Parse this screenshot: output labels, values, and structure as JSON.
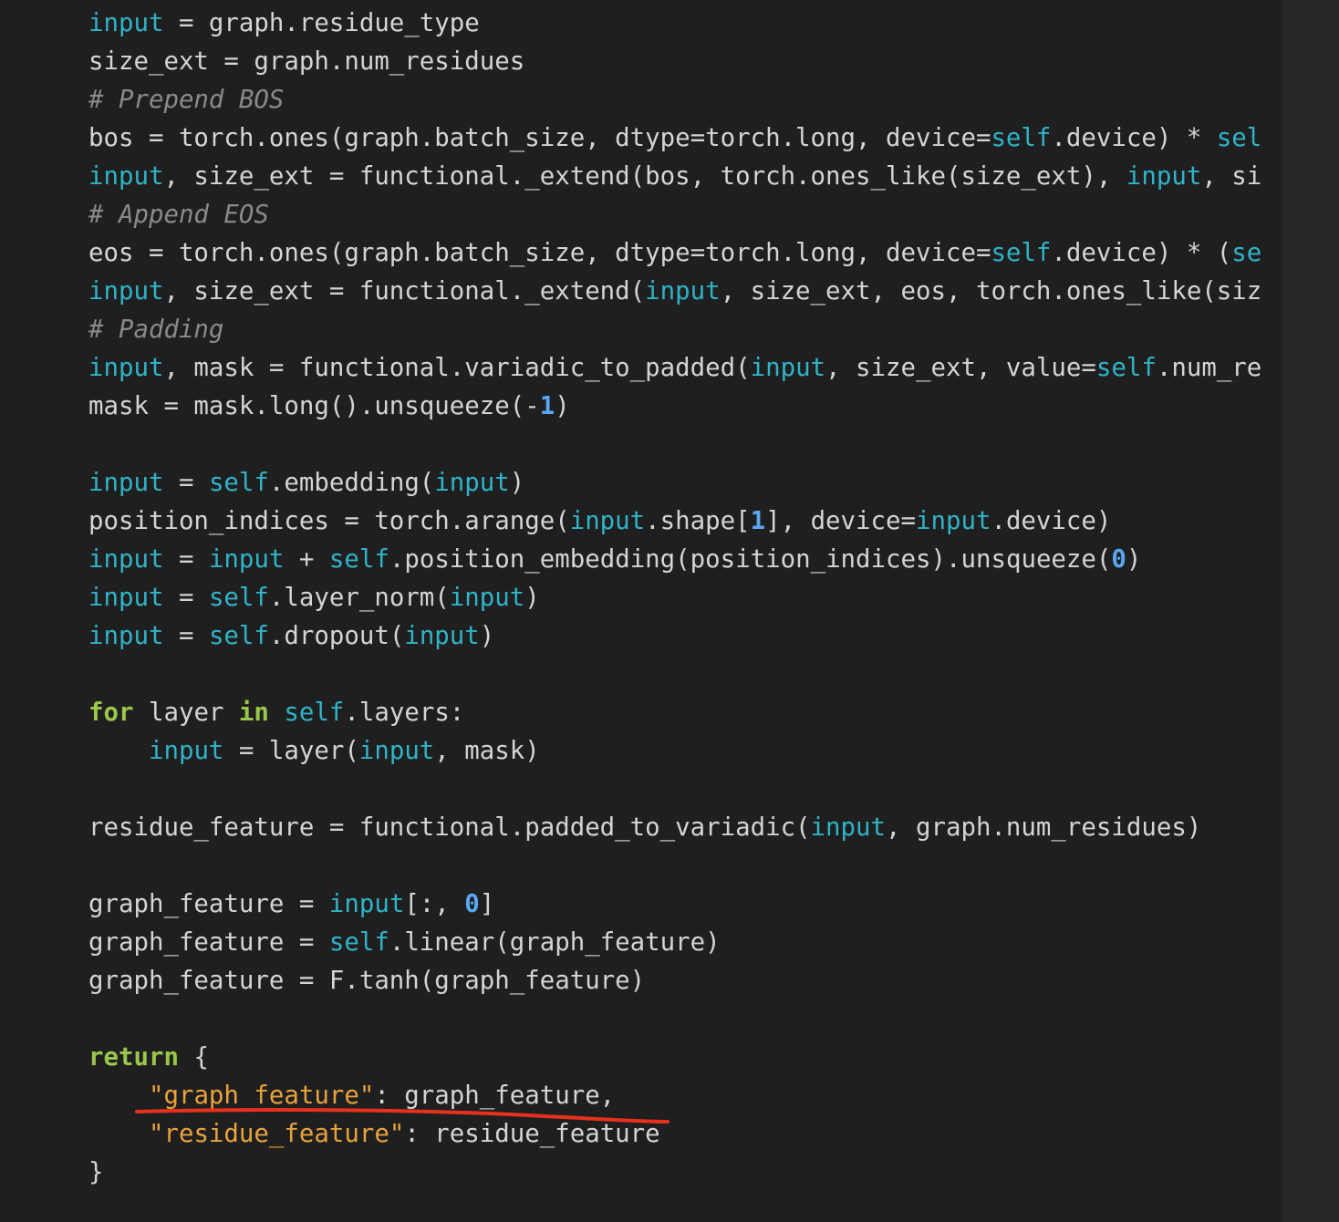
{
  "theme": {
    "background": "#1f1f1f",
    "text": "#d4d4d4",
    "keyword": "#9ac64b",
    "builtin_cyan": "#2fb3c8",
    "number": "#5aa8f4",
    "string": "#e8a33c",
    "comment": "#8a8a8a",
    "annotation_red": "#e8311c"
  },
  "code_lines": [
    [
      {
        "t": "input",
        "c": "cy"
      },
      {
        "t": " = graph.residue_type"
      }
    ],
    [
      {
        "t": "size_ext = graph.num_residues"
      }
    ],
    [
      {
        "t": "# Prepend BOS",
        "c": "cmt"
      }
    ],
    [
      {
        "t": "bos = torch.ones(graph.batch_size, dtype=torch.long, device="
      },
      {
        "t": "self",
        "c": "cy"
      },
      {
        "t": ".device) * "
      },
      {
        "t": "sel",
        "c": "cy"
      }
    ],
    [
      {
        "t": "input",
        "c": "cy"
      },
      {
        "t": ", size_ext = functional._extend(bos, torch.ones_like(size_ext), "
      },
      {
        "t": "input",
        "c": "cy"
      },
      {
        "t": ", si"
      }
    ],
    [
      {
        "t": "# Append EOS",
        "c": "cmt"
      }
    ],
    [
      {
        "t": "eos = torch.ones(graph.batch_size, dtype=torch.long, device="
      },
      {
        "t": "self",
        "c": "cy"
      },
      {
        "t": ".device) * ("
      },
      {
        "t": "se",
        "c": "cy"
      }
    ],
    [
      {
        "t": "input",
        "c": "cy"
      },
      {
        "t": ", size_ext = functional._extend("
      },
      {
        "t": "input",
        "c": "cy"
      },
      {
        "t": ", size_ext, eos, torch.ones_like(siz"
      }
    ],
    [
      {
        "t": "# Padding",
        "c": "cmt"
      }
    ],
    [
      {
        "t": "input",
        "c": "cy"
      },
      {
        "t": ", mask = functional.variadic_to_padded("
      },
      {
        "t": "input",
        "c": "cy"
      },
      {
        "t": ", size_ext, value="
      },
      {
        "t": "self",
        "c": "cy"
      },
      {
        "t": ".num_re"
      }
    ],
    [
      {
        "t": "mask = mask.long().unsqueeze(-"
      },
      {
        "t": "1",
        "c": "num"
      },
      {
        "t": ")"
      }
    ],
    [],
    [
      {
        "t": "input",
        "c": "cy"
      },
      {
        "t": " = "
      },
      {
        "t": "self",
        "c": "cy"
      },
      {
        "t": ".embedding("
      },
      {
        "t": "input",
        "c": "cy"
      },
      {
        "t": ")"
      }
    ],
    [
      {
        "t": "position_indices = torch.arange("
      },
      {
        "t": "input",
        "c": "cy"
      },
      {
        "t": ".shape["
      },
      {
        "t": "1",
        "c": "num"
      },
      {
        "t": "], device="
      },
      {
        "t": "input",
        "c": "cy"
      },
      {
        "t": ".device)"
      }
    ],
    [
      {
        "t": "input",
        "c": "cy"
      },
      {
        "t": " = "
      },
      {
        "t": "input",
        "c": "cy"
      },
      {
        "t": " + "
      },
      {
        "t": "self",
        "c": "cy"
      },
      {
        "t": ".position_embedding(position_indices).unsqueeze("
      },
      {
        "t": "0",
        "c": "num"
      },
      {
        "t": ")"
      }
    ],
    [
      {
        "t": "input",
        "c": "cy"
      },
      {
        "t": " = "
      },
      {
        "t": "self",
        "c": "cy"
      },
      {
        "t": ".layer_norm("
      },
      {
        "t": "input",
        "c": "cy"
      },
      {
        "t": ")"
      }
    ],
    [
      {
        "t": "input",
        "c": "cy"
      },
      {
        "t": " = "
      },
      {
        "t": "self",
        "c": "cy"
      },
      {
        "t": ".dropout("
      },
      {
        "t": "input",
        "c": "cy"
      },
      {
        "t": ")"
      }
    ],
    [],
    [
      {
        "t": "for",
        "c": "kw"
      },
      {
        "t": " layer "
      },
      {
        "t": "in",
        "c": "kw"
      },
      {
        "t": " "
      },
      {
        "t": "self",
        "c": "cy"
      },
      {
        "t": ".layers:"
      }
    ],
    [
      {
        "t": "    "
      },
      {
        "t": "input",
        "c": "cy"
      },
      {
        "t": " = layer("
      },
      {
        "t": "input",
        "c": "cy"
      },
      {
        "t": ", mask)"
      }
    ],
    [],
    [
      {
        "t": "residue_feature = functional.padded_to_variadic("
      },
      {
        "t": "input",
        "c": "cy"
      },
      {
        "t": ", graph.num_residues)"
      }
    ],
    [],
    [
      {
        "t": "graph_feature = "
      },
      {
        "t": "input",
        "c": "cy"
      },
      {
        "t": "[:, "
      },
      {
        "t": "0",
        "c": "num"
      },
      {
        "t": "]"
      }
    ],
    [
      {
        "t": "graph_feature = "
      },
      {
        "t": "self",
        "c": "cy"
      },
      {
        "t": ".linear(graph_feature)"
      }
    ],
    [
      {
        "t": "graph_feature = F.tanh(graph_feature)"
      }
    ],
    [],
    [
      {
        "t": "return",
        "c": "kw"
      },
      {
        "t": " {"
      }
    ],
    [
      {
        "t": "    "
      },
      {
        "t": "\"graph_feature\"",
        "c": "str"
      },
      {
        "t": ": graph_feature,"
      }
    ],
    [
      {
        "t": "    "
      },
      {
        "t": "\"residue_feature\"",
        "c": "str"
      },
      {
        "t": ": residue_feature"
      }
    ],
    [
      {
        "t": "}"
      }
    ]
  ]
}
